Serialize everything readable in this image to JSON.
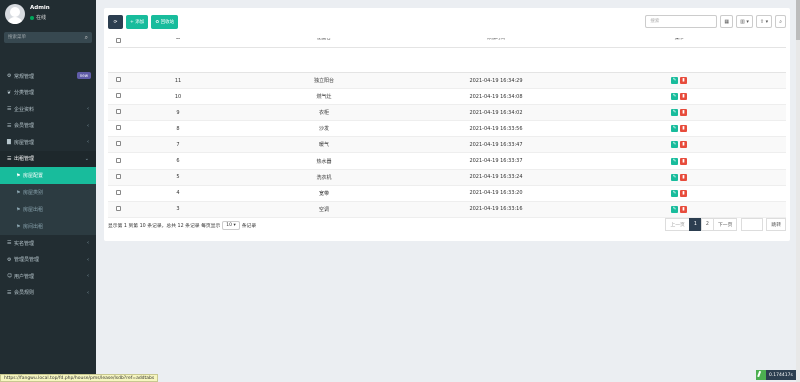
{
  "user": {
    "name": "Admin",
    "status": "在线"
  },
  "search": {
    "placeholder": "搜索菜单"
  },
  "menu": [
    {
      "label": "常规管理",
      "icon": "cogs-icon",
      "badge": "new"
    },
    {
      "label": "分类管理",
      "icon": "leaf-icon"
    },
    {
      "label": "企业资料",
      "icon": "list-icon"
    },
    {
      "label": "会员管理",
      "icon": "list-icon"
    },
    {
      "label": "房屋管理",
      "icon": "building-icon"
    },
    {
      "label": "出租管理",
      "icon": "list-icon",
      "open": true
    }
  ],
  "submenu": [
    {
      "label": "房屋配置",
      "active": true
    },
    {
      "label": "房屋类别"
    },
    {
      "label": "房屋出租"
    },
    {
      "label": "房间出租"
    }
  ],
  "menu2": [
    {
      "label": "实名管理",
      "icon": "list-icon"
    },
    {
      "label": "管理员管理",
      "icon": "gear-icon"
    },
    {
      "label": "用户管理",
      "icon": "user-icon"
    },
    {
      "label": "会员规则",
      "icon": "list-icon"
    }
  ],
  "toolbar": {
    "refresh": "⟳",
    "add": "添加",
    "recycle": "回收站",
    "search_placeholder": "搜索"
  },
  "table": {
    "columns": [
      "ID",
      "配置名",
      "添加时间",
      "操作"
    ],
    "rows": [
      {
        "id": "11",
        "name": "独立阳台",
        "time": "2021-04-19 16:34:29"
      },
      {
        "id": "10",
        "name": "燃气灶",
        "time": "2021-04-19 16:34:08"
      },
      {
        "id": "9",
        "name": "衣柜",
        "time": "2021-04-19 16:34:02"
      },
      {
        "id": "8",
        "name": "沙发",
        "time": "2021-04-19 16:33:56"
      },
      {
        "id": "7",
        "name": "暖气",
        "time": "2021-04-19 16:33:47"
      },
      {
        "id": "6",
        "name": "热水器",
        "time": "2021-04-19 16:33:37"
      },
      {
        "id": "5",
        "name": "洗衣机",
        "time": "2021-04-19 16:33:24"
      },
      {
        "id": "4",
        "name": "宽带",
        "time": "2021-04-19 16:33:20"
      },
      {
        "id": "3",
        "name": "空调",
        "time": "2021-04-19 16:33:16"
      }
    ]
  },
  "pagination": {
    "info_prefix": "显示第 1 到第 10 条记录，总共 12 条记录 每页显示",
    "page_size": "10",
    "info_suffix": "条记录",
    "prev": "上一页",
    "page1": "1",
    "page2": "2",
    "next": "下一页",
    "jump": "跳转"
  },
  "status_url": "https://fangwu.local.top/fd.php/house/pms/lease/lsdb?ref=addtabs",
  "timer": "0.174417s"
}
